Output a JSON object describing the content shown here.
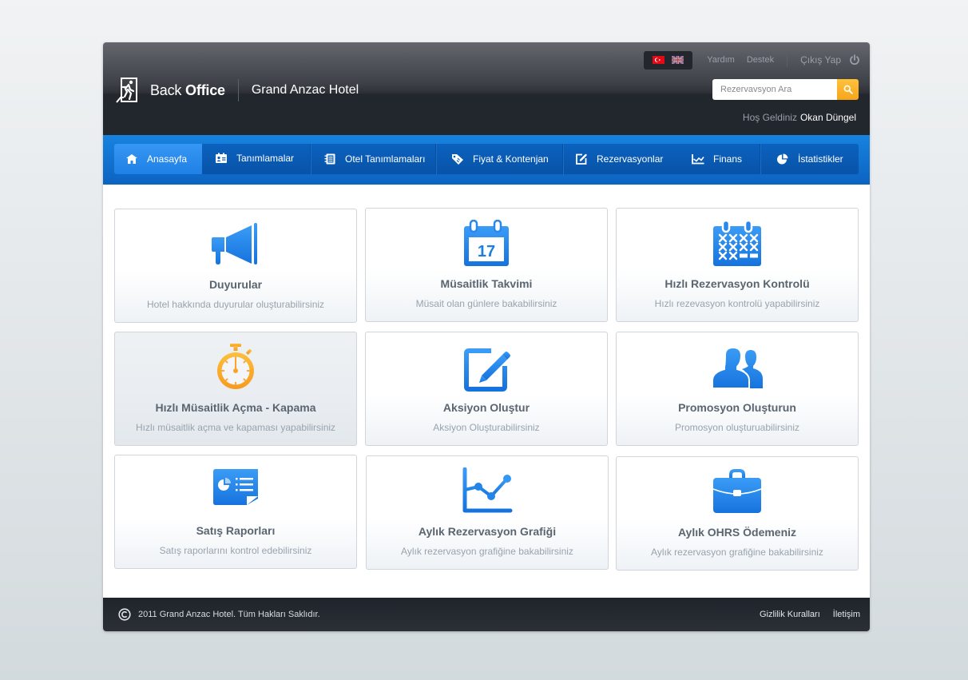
{
  "header": {
    "brand_light": "Back ",
    "brand_bold": "Office",
    "hotel_name": "Grand Anzac Hotel",
    "languages": [
      {
        "code": "tr",
        "icon": "turkish-flag-icon"
      },
      {
        "code": "en",
        "icon": "uk-flag-icon"
      }
    ],
    "links": [
      "Yardım",
      "Destek"
    ],
    "logout_label": "Çıkış Yap",
    "search_placeholder": "Rezervavsyon Ara",
    "welcome_label": "Hoş Geldiniz",
    "user_name": "Okan Düngel"
  },
  "nav": {
    "items": [
      {
        "label": "Anasayfa",
        "icon": "home-icon",
        "active": true
      },
      {
        "label": "Tanımlamalar",
        "icon": "id-card-icon"
      },
      {
        "label": "Otel Tanımlamaları",
        "icon": "notebook-icon"
      },
      {
        "label": "Fiyat & Kontenjan",
        "icon": "price-tag-icon"
      },
      {
        "label": "Rezervasyonlar",
        "icon": "edit-icon"
      },
      {
        "label": "Finans",
        "icon": "line-chart-icon"
      },
      {
        "label": "İstatistikler",
        "icon": "pie-chart-icon"
      }
    ]
  },
  "cards": [
    {
      "title": "Duyurular",
      "desc": "Hotel hakkında duyurular oluşturabilirsiniz",
      "icon": "megaphone-icon"
    },
    {
      "title": "Müsaitlik Takvimi",
      "desc": "Müsait olan günlere bakabilirsiniz",
      "icon": "calendar-icon",
      "calendar_day": "17"
    },
    {
      "title": "Hızlı Rezervasyon Kontrolü",
      "desc": "Hızlı rezevasyon kontrolü yapabilirsiniz",
      "icon": "calendar-check-icon"
    },
    {
      "title": "Hızlı Müsaitlik Açma - Kapama",
      "desc": "Hızlı müsaitlik açma ve kapaması yapabilirsiniz",
      "icon": "stopwatch-icon",
      "active": true
    },
    {
      "title": "Aksiyon Oluştur",
      "desc": "Aksiyon Oluşturabilirsiniz",
      "icon": "edit-icon"
    },
    {
      "title": "Promosyon Oluşturun",
      "desc": "Promosyon oluşturuabilirsiniz",
      "icon": "users-icon"
    },
    {
      "title": "Satış Raporları",
      "desc": "Satış raporlarını kontrol edebilirsiniz",
      "icon": "report-icon"
    },
    {
      "title": "Aylık Rezervasyon Grafiği",
      "desc": "Aylık rezervasyon grafiğine bakabilirsiniz",
      "icon": "line-chart-icon"
    },
    {
      "title": "Aylık OHRS Ödemeniz",
      "desc": "Aylık rezervasyon grafiğine bakabilirsiniz",
      "icon": "briefcase-icon"
    }
  ],
  "footer": {
    "copyright": "2011  Grand Anzac Hotel. Tüm Hakları Saklıdır.",
    "links": [
      "Gizlilik Kuralları",
      "İletişim"
    ]
  },
  "colors": {
    "accent_blue": "#1a7fe0",
    "nav_blue": "#0c63c0",
    "search_button": "#f7a51a",
    "stopwatch_orange": "#fba72a",
    "header_dark": "#22262d"
  }
}
